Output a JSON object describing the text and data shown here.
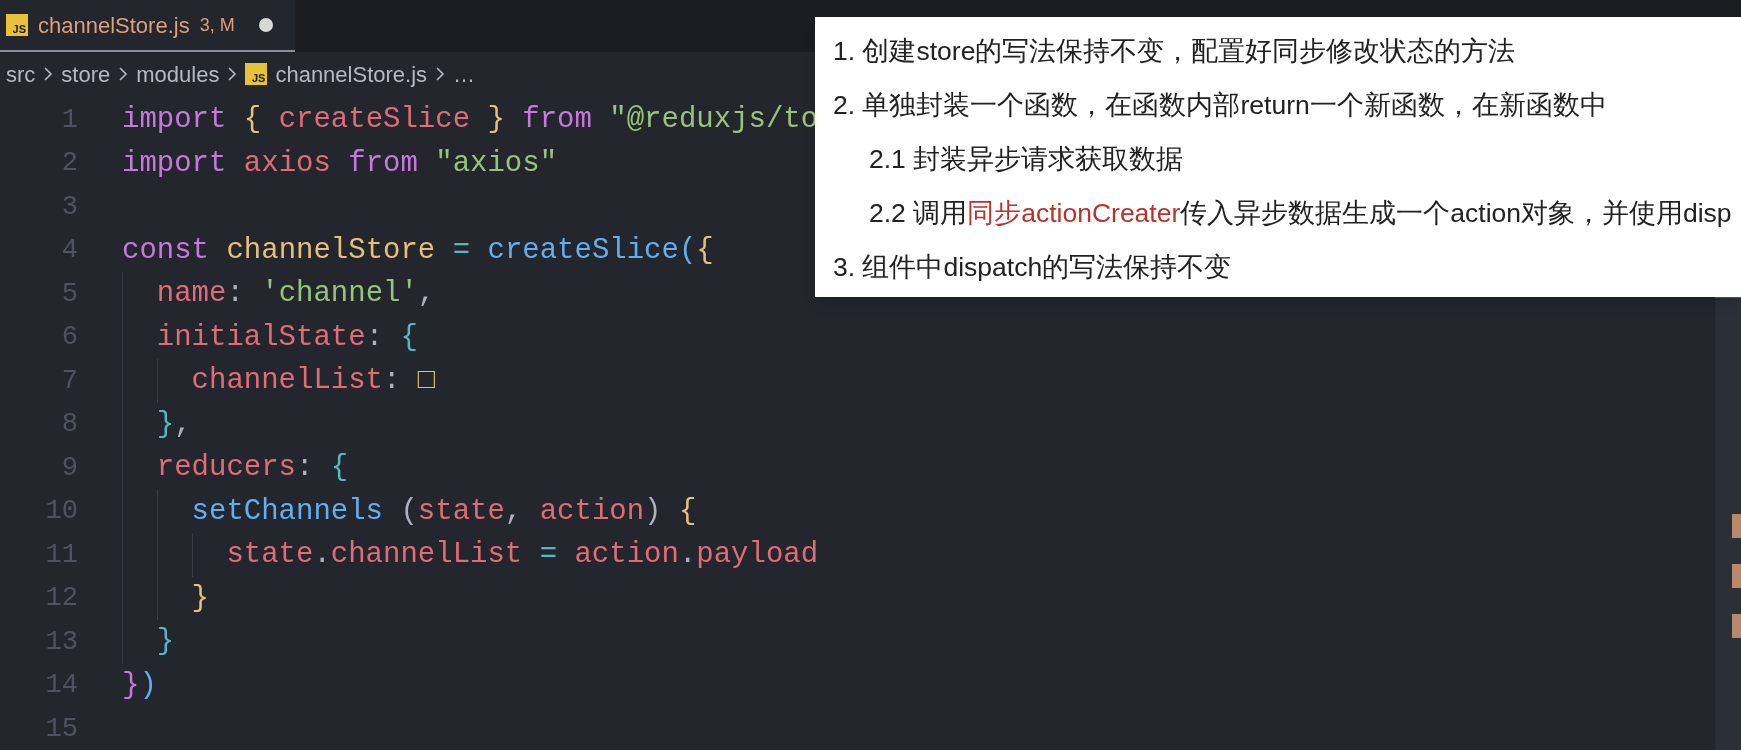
{
  "tabs": [
    {
      "icon_text": "JS",
      "label": "channelStore.js",
      "badge": "3, M",
      "selected": true,
      "unsaved": true
    }
  ],
  "breadcrumb": [
    {
      "text": "src",
      "kind": "folder"
    },
    {
      "text": "store",
      "kind": "folder"
    },
    {
      "text": "modules",
      "kind": "folder"
    },
    {
      "text": "channelStore.js",
      "kind": "file",
      "icon_text": "JS"
    },
    {
      "text": "…",
      "kind": "symbol"
    }
  ],
  "code_lines": [
    {
      "number": "1",
      "tokens": [
        {
          "kind": "keyword",
          "text": "import"
        },
        {
          "kind": "brace1",
          "text": " {"
        },
        {
          "kind": "variable",
          "text": " createSlice"
        },
        {
          "kind": "brace1",
          "text": " }"
        },
        {
          "kind": "keyword",
          "text": " from"
        },
        {
          "kind": "string",
          "text": " \"@reduxjs/to"
        }
      ]
    },
    {
      "number": "2",
      "tokens": [
        {
          "kind": "keyword",
          "text": "import"
        },
        {
          "kind": "variable",
          "text": " axios"
        },
        {
          "kind": "keyword",
          "text": " from"
        },
        {
          "kind": "string",
          "text": " \"axios\""
        }
      ]
    },
    {
      "number": "3"
    },
    {
      "number": "4",
      "tokens": [
        {
          "kind": "keyword",
          "text": "const"
        },
        {
          "kind": "constant",
          "text": " channelStore"
        },
        {
          "kind": "operator",
          "text": " ="
        },
        {
          "kind": "function",
          "text": " createSlice"
        },
        {
          "kind": "paren",
          "text": "("
        },
        {
          "kind": "brace1",
          "text": "{"
        }
      ],
      "children": [
        {
          "number": "5",
          "tokens": [
            {
              "kind": "property",
              "text": "name"
            },
            {
              "kind": "punct",
              "text": ":"
            },
            {
              "kind": "string",
              "text": " 'channel'"
            },
            {
              "kind": "punct",
              "text": ","
            }
          ]
        },
        {
          "number": "6",
          "tokens": [
            {
              "kind": "property",
              "text": "initialState"
            },
            {
              "kind": "punct",
              "text": ":"
            },
            {
              "kind": "brace2",
              "text": " {"
            }
          ],
          "children": [
            {
              "number": "7",
              "tokens": [
                {
                  "kind": "property",
                  "text": "channelList"
                },
                {
                  "kind": "punct",
                  "text": ":"
                },
                {
                  "kind": "brace1",
                  "text": " □"
                }
              ]
            }
          ]
        },
        {
          "number": "8",
          "tokens": [
            {
              "kind": "brace2",
              "text": "}"
            },
            {
              "kind": "punct",
              "text": ","
            }
          ]
        },
        {
          "number": "9",
          "tokens": [
            {
              "kind": "property",
              "text": "reducers"
            },
            {
              "kind": "punct",
              "text": ":"
            },
            {
              "kind": "brace2",
              "text": " {"
            }
          ],
          "children": [
            {
              "number": "10",
              "tokens": [
                {
                  "kind": "function",
                  "text": "setChannels"
                },
                {
                  "kind": "punct",
                  "text": " ("
                },
                {
                  "kind": "property",
                  "text": "state"
                },
                {
                  "kind": "punct",
                  "text": ","
                },
                {
                  "kind": "property",
                  "text": " action"
                },
                {
                  "kind": "punct",
                  "text": ")"
                },
                {
                  "kind": "brace1",
                  "text": " {"
                }
              ],
              "children": [
                {
                  "number": "11",
                  "tokens": [
                    {
                      "kind": "property",
                      "text": "state"
                    },
                    {
                      "kind": "punct",
                      "text": "."
                    },
                    {
                      "kind": "property",
                      "text": "channelList"
                    },
                    {
                      "kind": "operator",
                      "text": " ="
                    },
                    {
                      "kind": "property",
                      "text": " action"
                    },
                    {
                      "kind": "punct",
                      "text": "."
                    },
                    {
                      "kind": "property",
                      "text": "payload"
                    }
                  ]
                }
              ]
            },
            {
              "number": "12",
              "tokens": [
                {
                  "kind": "brace1",
                  "text": "}"
                }
              ]
            }
          ]
        },
        {
          "number": "13",
          "tokens": [
            {
              "kind": "brace2",
              "text": "}"
            }
          ]
        }
      ]
    },
    {
      "number": "14",
      "tokens": [
        {
          "kind": "brace3",
          "text": "}"
        },
        {
          "kind": "paren",
          "text": ")"
        }
      ]
    },
    {
      "number": "15"
    }
  ],
  "note": {
    "items": [
      {
        "segments": [
          {
            "text": "1. 创建store的写法保持不变，配置好同步修改状态的方法",
            "highlight": false
          }
        ]
      },
      {
        "segments": [
          {
            "text": "2. 单独封装一个函数，在函数内部return一个新函数，在新函数中",
            "highlight": false
          }
        ],
        "children": [
          {
            "segments": [
              {
                "text": "2.1 封装异步请求获取数据",
                "highlight": false
              }
            ]
          },
          {
            "segments": [
              {
                "text": "2.2 调用",
                "highlight": false
              },
              {
                "text": "同步actionCreater",
                "highlight": true
              },
              {
                "text": "传入异步数据生成一个action对象，并使用disp",
                "highlight": false
              }
            ]
          }
        ]
      },
      {
        "segments": [
          {
            "text": "3. 组件中dispatch的写法保持不变",
            "highlight": false
          }
        ]
      }
    ]
  }
}
